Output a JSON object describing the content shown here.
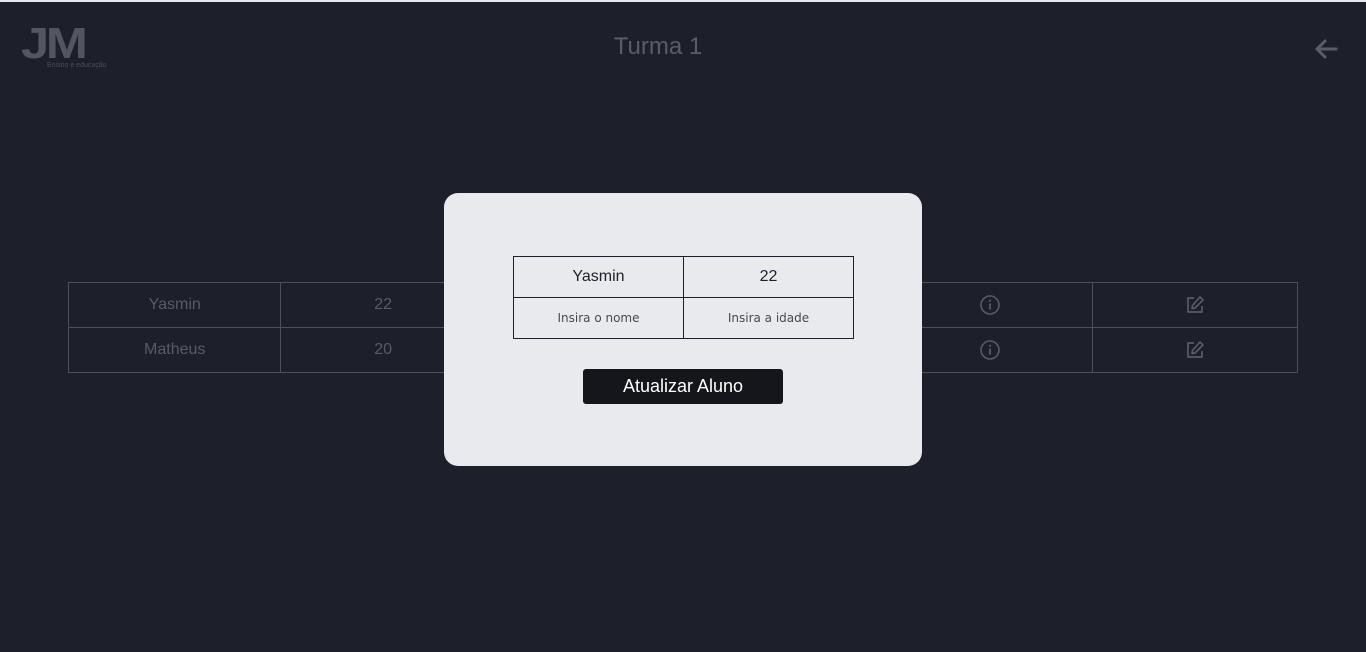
{
  "header": {
    "logo_text": "JM",
    "logo_subtitle": "Ensino e educação",
    "title": "Turma 1"
  },
  "students": [
    {
      "name": "Yasmin",
      "age": "22"
    },
    {
      "name": "Matheus",
      "age": "20"
    }
  ],
  "modal": {
    "current_name": "Yasmin",
    "current_age": "22",
    "name_placeholder": "Insira o nome",
    "age_placeholder": "Insira a idade",
    "submit_label": "Atualizar Aluno"
  },
  "icons": {
    "back": "arrow-left-icon",
    "info": "info-icon",
    "edit": "edit-icon"
  },
  "colors": {
    "background": "#1d202a",
    "modal_background": "#e9eaee",
    "button": "#14161c"
  }
}
